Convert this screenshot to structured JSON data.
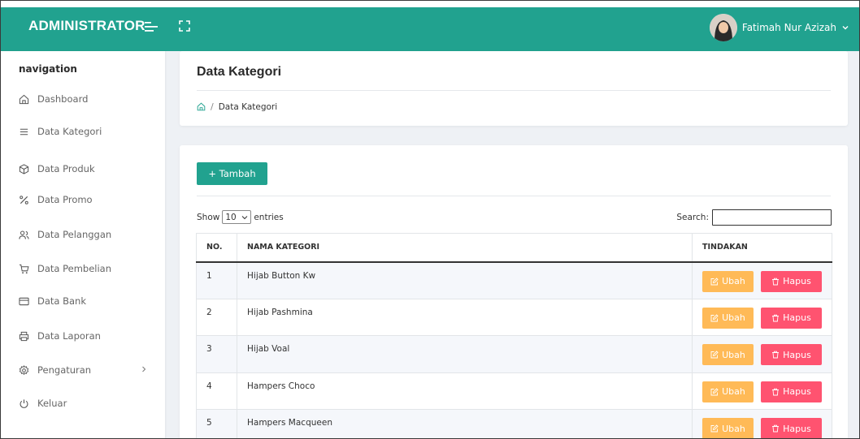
{
  "header": {
    "brand": "ADMINISTRATOR",
    "user_name": "Fatimah Nur Azizah",
    "accent_color": "#21a28f"
  },
  "sidebar": {
    "title": "navigation",
    "items": [
      {
        "label": "Dashboard",
        "icon": "home-icon"
      },
      {
        "label": "Data Kategori",
        "icon": "list-icon"
      },
      {
        "label": "Data Produk",
        "icon": "box-icon"
      },
      {
        "label": "Data Promo",
        "icon": "percent-icon"
      },
      {
        "label": "Data Pelanggan",
        "icon": "users-icon"
      },
      {
        "label": "Data Pembelian",
        "icon": "cart-icon"
      },
      {
        "label": "Data Bank",
        "icon": "credit-card-icon"
      },
      {
        "label": "Data Laporan",
        "icon": "printer-icon"
      },
      {
        "label": "Pengaturan",
        "icon": "settings-icon"
      },
      {
        "label": "Keluar",
        "icon": "power-icon"
      }
    ]
  },
  "page": {
    "title": "Data Kategori",
    "breadcrumb_current": "Data Kategori"
  },
  "toolbar": {
    "add_label": "+ Tambah"
  },
  "datatable": {
    "show_label": "Show",
    "length_value": "10",
    "entries_label": "entries",
    "search_label": "Search:",
    "search_value": "",
    "columns": [
      "NO.",
      "NAMA KATEGORI",
      "TINDAKAN"
    ],
    "rows": [
      {
        "no": "1",
        "name": "Hijab Button Kw"
      },
      {
        "no": "2",
        "name": "Hijab Pashmina"
      },
      {
        "no": "3",
        "name": "Hijab Voal"
      },
      {
        "no": "4",
        "name": "Hampers Choco"
      },
      {
        "no": "5",
        "name": "Hampers Macqueen"
      }
    ],
    "edit_label": "Ubah",
    "delete_label": "Hapus",
    "edit_color": "#ffba57",
    "delete_color": "#ff5370"
  }
}
